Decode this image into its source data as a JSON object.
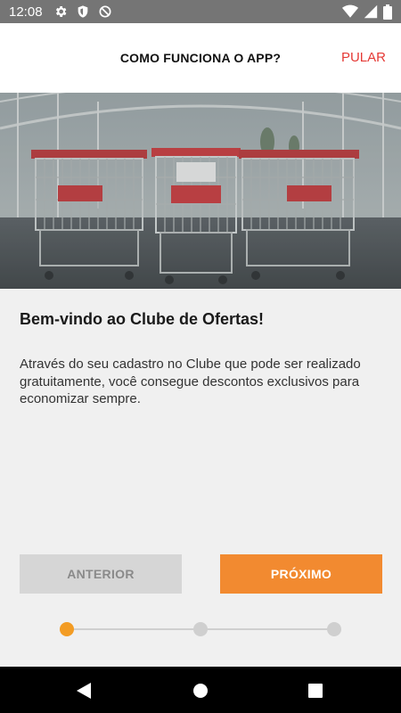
{
  "status_bar": {
    "time": "12:08",
    "icons": [
      "gear-icon",
      "shield-icon",
      "do-not-disturb-icon",
      "wifi-icon",
      "cell-signal-icon",
      "battery-icon"
    ]
  },
  "app_bar": {
    "title": "COMO FUNCIONA O APP?",
    "skip_label": "PULAR"
  },
  "onboarding": {
    "image": "shopping-carts-image",
    "heading": "Bem-vindo ao Clube de Ofertas!",
    "description": "Através do seu cadastro no Clube que pode ser realizado gratuitamente, você consegue descontos exclusivos para economizar sempre.",
    "prev_label": "ANTERIOR",
    "next_label": "PRÓXIMO",
    "total_steps": 3,
    "current_step": 1
  },
  "nav_bar": {
    "icons": [
      "back-icon",
      "home-icon",
      "recents-icon"
    ]
  },
  "colors": {
    "accent": "#f28a30",
    "skip": "#e53935",
    "status_bar": "#757575",
    "disabled_button": "#d6d6d6"
  }
}
